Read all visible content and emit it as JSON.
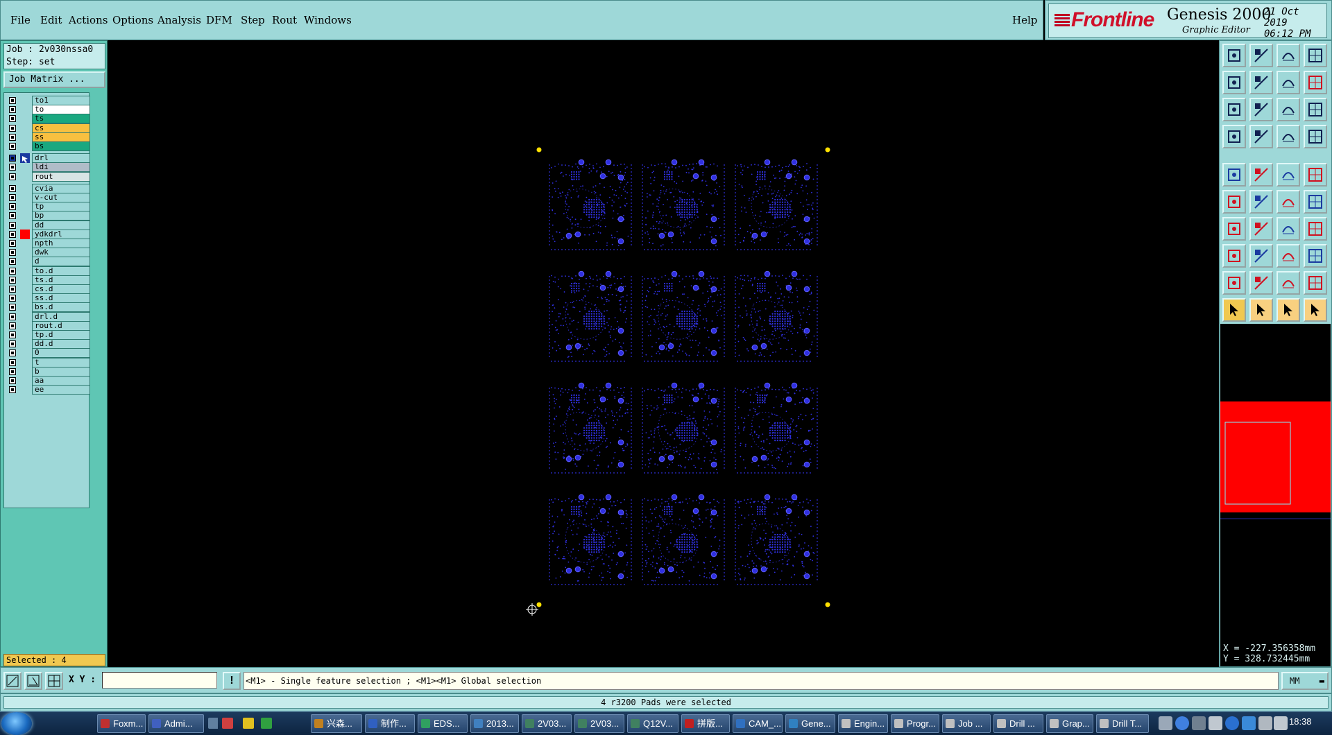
{
  "menu": [
    "File",
    "Edit",
    "Actions",
    "Options",
    "Analysis",
    "DFM",
    "Step",
    "Rout",
    "Windows"
  ],
  "help": "Help",
  "brand": {
    "logo": "Frontline",
    "product": "Genesis 2000",
    "subtitle": "Graphic Editor",
    "date": "21 Oct 2019",
    "time": "06:12 PM",
    "logo_color": "#d0102a"
  },
  "job": {
    "job_line": "Job : 2v030nssa0",
    "step_line": "Step: set",
    "matrix_button": "Job Matrix ..."
  },
  "layers": [
    {
      "name": "to1",
      "color": "#9ed8d8"
    },
    {
      "name": "to",
      "color": "#ffffff"
    },
    {
      "name": "ts",
      "color": "#1aa880"
    },
    {
      "name": "cs",
      "color": "#f8c040"
    },
    {
      "name": "ss",
      "color": "#f8c040"
    },
    {
      "name": "bs",
      "color": "#1aa880"
    },
    {
      "name": "drl",
      "color": "#9ed8d8",
      "active": true
    },
    {
      "name": "ldi",
      "color": "#b0bcc8"
    },
    {
      "name": "rout",
      "color": "#d8e4e4"
    },
    {
      "name": "cvia",
      "color": "#9ed8d8"
    },
    {
      "name": "v-cut",
      "color": "#9ed8d8"
    },
    {
      "name": "tp",
      "color": "#9ed8d8"
    },
    {
      "name": "bp",
      "color": "#9ed8d8"
    },
    {
      "name": "dd",
      "color": "#9ed8d8"
    },
    {
      "name": "ydkdrl",
      "color": "#9ed8d8",
      "marker": "#ff0000"
    },
    {
      "name": "npth",
      "color": "#9ed8d8"
    },
    {
      "name": "dwk",
      "color": "#9ed8d8"
    },
    {
      "name": "d",
      "color": "#9ed8d8"
    },
    {
      "name": "to.d",
      "color": "#9ed8d8"
    },
    {
      "name": "ts.d",
      "color": "#9ed8d8"
    },
    {
      "name": "cs.d",
      "color": "#9ed8d8"
    },
    {
      "name": "ss.d",
      "color": "#9ed8d8"
    },
    {
      "name": "bs.d",
      "color": "#9ed8d8"
    },
    {
      "name": "drl.d",
      "color": "#9ed8d8"
    },
    {
      "name": "rout.d",
      "color": "#9ed8d8"
    },
    {
      "name": "tp.d",
      "color": "#9ed8d8"
    },
    {
      "name": "dd.d",
      "color": "#9ed8d8"
    },
    {
      "name": "0",
      "color": "#9ed8d8"
    },
    {
      "name": "t",
      "color": "#9ed8d8"
    },
    {
      "name": "b",
      "color": "#9ed8d8"
    },
    {
      "name": "aa",
      "color": "#9ed8d8"
    },
    {
      "name": "ee",
      "color": "#9ed8d8"
    }
  ],
  "selected": "Selected : 4",
  "canvas": {
    "background": "#000000",
    "feature_color": "#3030e0",
    "datum_color": "#ffe000",
    "panel_rows": 4,
    "panel_cols": 3
  },
  "toolbar_icons": [
    "zoom-home-icon",
    "zoom-save-icon",
    "home-icon",
    "split-view-icon",
    "pan-left-icon",
    "pan-right-icon",
    "undo-icon",
    "redo-icon",
    "fit-icon",
    "fit-profile-icon",
    "scale-icon",
    "help-icon",
    "measure-icon",
    "probe-icon",
    "filter-icon",
    "filter-popup-icon",
    "add-pad-icon",
    "add-line-icon",
    "ruler-icon",
    "snap-icon",
    "connect-icon",
    "delete-icon",
    "arc-icon",
    "break-icon",
    "angle-icon",
    "slope-icon",
    "rotate-icon",
    "font-icon",
    "copy-icon",
    "minus-icon",
    "spacing-icon",
    "transform-icon",
    "angle-tri-icon",
    "text-a-icon",
    "text-a-red-icon",
    "text-a-arc-icon",
    "select-pointer-icon",
    "select-edit-icon",
    "select-move-icon",
    "select-route-icon"
  ],
  "coords": {
    "x": "X = -227.356358mm",
    "y": "Y = 328.732445mm"
  },
  "command": {
    "xy_label": "X Y :",
    "xy_value": "",
    "prompt": "<M1> - Single feature selection ; <M1><M1> Global selection",
    "unit": "MM"
  },
  "status": "4 r3200 Pads were selected",
  "taskbar": {
    "tasks": [
      "Foxm...",
      "Admi...",
      "",
      "",
      "",
      "",
      "兴森...",
      "制作...",
      "EDS...",
      "2013...",
      "2V03...",
      "2V03...",
      "Q12V...",
      "拼版...",
      "CAM_...",
      "Gene...",
      "Engin...",
      "Progr...",
      "Job ...",
      "Drill ...",
      "Grap...",
      "Drill T..."
    ],
    "clock": "18:38"
  }
}
